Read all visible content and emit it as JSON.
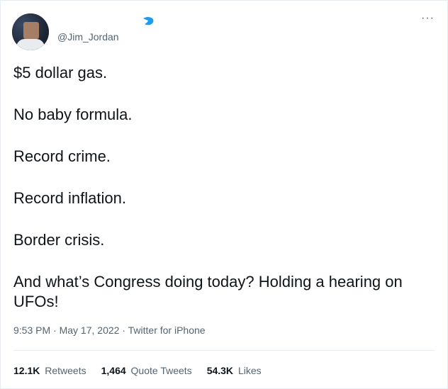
{
  "author": {
    "handle": "@Jim_Jordan"
  },
  "menu": {
    "more_label": "···"
  },
  "tweet": {
    "lines": [
      "$5 dollar gas.",
      "No baby formula.",
      "Record crime.",
      "Record inflation.",
      "Border crisis.",
      "And what’s Congress doing today? Holding a hearing on UFOs!"
    ],
    "time": "9:53 PM",
    "date": "May 17, 2022",
    "separator": "·",
    "source": "Twitter for iPhone"
  },
  "stats": {
    "retweets_count": "12.1K",
    "retweets_label": "Retweets",
    "quotes_count": "1,464",
    "quotes_label": "Quote Tweets",
    "likes_count": "54.3K",
    "likes_label": "Likes"
  },
  "colors": {
    "text": "#0f1419",
    "secondary": "#536471",
    "verified": "#1d9bf0",
    "divider": "#e6ecf0"
  },
  "icons": {
    "verified": "verified-badge-icon",
    "more": "more-options-icon"
  }
}
